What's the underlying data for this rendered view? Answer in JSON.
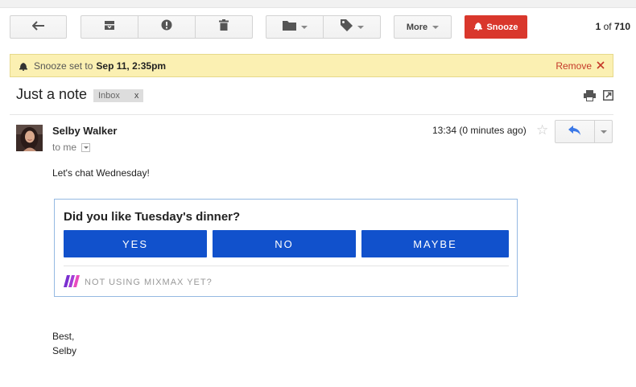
{
  "toolbar": {
    "back_icon": "back-arrow-icon",
    "archive_icon": "archive-icon",
    "spam_icon": "report-spam-icon",
    "delete_icon": "trash-icon",
    "move_icon": "folder-icon",
    "labels_icon": "tag-icon",
    "more_label": "More",
    "snooze_label": "Snooze",
    "snooze_icon": "snooze-bell-icon",
    "accent": "#d9372c"
  },
  "pager": {
    "range": "1",
    "of": "of",
    "total": "710"
  },
  "banner": {
    "text": "Snooze set to",
    "datetime": "Sep 11, 2:35pm",
    "remove_label": "Remove",
    "background": "#fbf0b2"
  },
  "message": {
    "subject": "Just a note",
    "label": "Inbox",
    "label_remove": "x",
    "print_icon": "print-icon",
    "newwindow_icon": "new-window-icon",
    "sender": "Selby Walker",
    "to": "to me",
    "time": "13:34 (0 minutes ago)",
    "star": "☆",
    "reply_icon": "reply-icon",
    "body_line": "Let's chat Wednesday!",
    "sign_off": "Best,",
    "signature": "Selby"
  },
  "poll": {
    "question": "Did you like Tuesday's dinner?",
    "options": [
      "YES",
      "NO",
      "MAYBE"
    ],
    "footer": "NOT USING MIXMAX YET?",
    "button_color": "#1151cc",
    "logo_colors": [
      "#7b2fd0",
      "#e94bbf"
    ]
  }
}
